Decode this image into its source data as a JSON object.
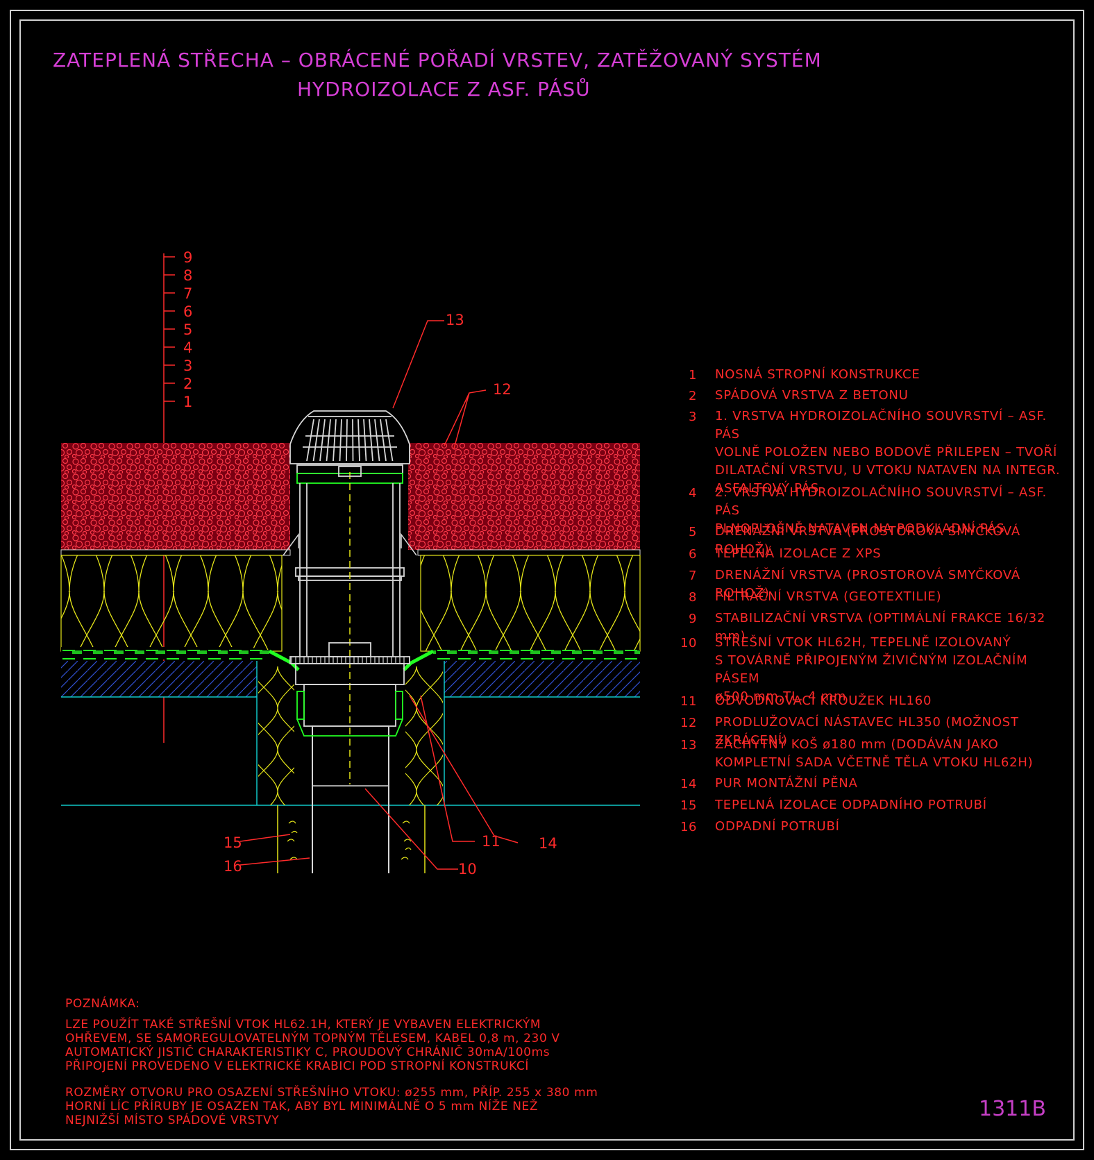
{
  "title": {
    "line1": "ZATEPLENÁ STŘECHA – OBRÁCENÉ POŘADÍ VRSTEV, ZATĚŽOVANÝ SYSTÉM",
    "line2": "HYDROIZOLACE Z ASF. PÁSŮ"
  },
  "layer_scale": [
    "9",
    "8",
    "7",
    "6",
    "5",
    "4",
    "3",
    "2",
    "1"
  ],
  "callouts": {
    "c13": "13",
    "c12": "12",
    "c15": "15",
    "c16": "16",
    "c11": "11",
    "c14": "14",
    "c10": "10"
  },
  "legend": [
    {
      "num": "1",
      "text": "NOSNÁ STROPNÍ KONSTRUKCE"
    },
    {
      "num": "2",
      "text": "SPÁDOVÁ VRSTVA Z BETONU"
    },
    {
      "num": "3",
      "text": "1. VRSTVA HYDROIZOLAČNÍHO SOUVRSTVÍ – ASF. PÁS\nVOLNĚ POLOŽEN NEBO BODOVĚ PŘILEPEN – TVOŘÍ\nDILATAČNÍ VRSTVU, U VTOKU NATAVEN NA INTEGR.\nASFALTOVÝ PÁS"
    },
    {
      "num": "4",
      "text": "2. VRSTVA HYDROIZOLAČNÍHO SOUVRSTVÍ – ASF. PÁS\nPLNOPLOŠNĚ NATAVEN NA PODKLADNÍ PÁS"
    },
    {
      "num": "5",
      "text": "DRENÁŽNÍ VRSTVA (PROSTOROVÁ SMYČKOVÁ ROHOŽ)"
    },
    {
      "num": "6",
      "text": "TEPELNÁ IZOLACE Z XPS"
    },
    {
      "num": "7",
      "text": "DRENÁŽNÍ VRSTVA (PROSTOROVÁ SMYČKOVÁ ROHOŽ)"
    },
    {
      "num": "8",
      "text": "FILTRAČNÍ VRSTVA (GEOTEXTILIE)"
    },
    {
      "num": "9",
      "text": "STABILIZAČNÍ VRSTVA (OPTIMÁLNÍ FRAKCE 16/32 mm)"
    },
    {
      "num": "10",
      "text": "STŘEŠNÍ VTOK HL62H, TEPELNĚ IZOLOVANÝ\nS TOVÁRNĚ PŘIPOJENÝM ŽIVIČNÝM IZOLAČNÍM PÁSEM\nø500 mm,TL. 4 mm"
    },
    {
      "num": "11",
      "text": "ODVODŇOVACÍ KROUŽEK HL160"
    },
    {
      "num": "12",
      "text": "PRODLUŽOVACÍ NÁSTAVEC HL350 (MOŽNOST ZKRÁCENÍ)"
    },
    {
      "num": "13",
      "text": "ZÁCHYTNÝ KOŠ ø180 mm (DODÁVÁN JAKO\nKOMPLETNÍ SADA VČETNĚ TĚLA VTOKU HL62H)"
    },
    {
      "num": "14",
      "text": "PUR MONTÁŽNÍ PĚNA"
    },
    {
      "num": "15",
      "text": "TEPELNÁ IZOLACE ODPADNÍHO POTRUBÍ"
    },
    {
      "num": "16",
      "text": "ODPADNÍ POTRUBÍ"
    }
  ],
  "note": {
    "heading": "POZNÁMKA:",
    "para1": "LZE POUŽÍT TAKÉ STŘEŠNÍ VTOK HL62.1H, KTERÝ JE VYBAVEN ELEKTRICKÝM\nOHŘEVEM, SE SAMOREGULOVATELNÝM TOPNÝM TĚLESEM, KABEL 0,8 m, 230 V\nAUTOMATICKÝ JISTIČ CHARAKTERISTIKY C, PROUDOVÝ CHRÁNIČ 30mA/100ms\nPŘIPOJENÍ PROVEDENO V ELEKTRICKÉ KRABICI POD STROPNÍ KONSTRUKCÍ",
    "para2": "ROZMĚRY OTVORU PRO OSAZENÍ STŘEŠNÍHO VTOKU: ø255 mm, PŘÍP. 255 x 380 mm\nHORNÍ LÍC PŘÍRUBY JE OSAZEN TAK, ABY BYL MINIMÁLNĚ O 5 mm NÍŽE NEŽ\nNEJNIŽŠÍ MÍSTO SPÁDOVÉ VRSTVY"
  },
  "drawing_code": "1311B",
  "colors": {
    "title": "#d63fd6",
    "text": "#ff2a2a",
    "gravel": "#c8102a",
    "insulation": "#e6e619",
    "membrane": "#22ff22",
    "screed": "#3050d0",
    "slab_line": "#10c8c8",
    "drain": "#d8d8d8"
  }
}
